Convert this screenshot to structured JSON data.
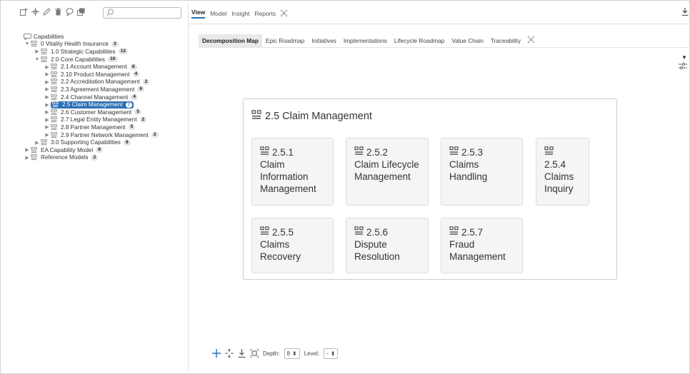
{
  "toolbar": {
    "icons": [
      "add-icon",
      "move-icon",
      "edit-icon",
      "delete-icon",
      "comment-icon",
      "copy-icon"
    ],
    "search_placeholder": ""
  },
  "tree": {
    "root_label": "Capabilities",
    "items": [
      {
        "label": "0 Vitality Health Insurance",
        "badge": "3",
        "level": 0,
        "expanded": true
      },
      {
        "label": "1.0 Strategic Capabilities",
        "badge": "12",
        "level": 1,
        "expanded": false
      },
      {
        "label": "2.0 Core Capabilities",
        "badge": "10",
        "level": 1,
        "expanded": true
      },
      {
        "label": "2.1 Account Management",
        "badge": "8",
        "level": 2,
        "expanded": false
      },
      {
        "label": "2.10 Product Management",
        "badge": "4",
        "level": 2,
        "expanded": false
      },
      {
        "label": "2.2 Accreditation Management",
        "badge": "2",
        "level": 2,
        "expanded": false
      },
      {
        "label": "2.3 Agreement Management",
        "badge": "6",
        "level": 2,
        "expanded": false
      },
      {
        "label": "2.4 Channel Management",
        "badge": "4",
        "level": 2,
        "expanded": false
      },
      {
        "label": "2.5 Claim Management",
        "badge": "7",
        "level": 2,
        "expanded": false,
        "selected": true
      },
      {
        "label": "2.6 Customer Management",
        "badge": "5",
        "level": 2,
        "expanded": false
      },
      {
        "label": "2.7 Legal Entity Management",
        "badge": "2",
        "level": 2,
        "expanded": false
      },
      {
        "label": "2.8 Partner Management",
        "badge": "5",
        "level": 2,
        "expanded": false
      },
      {
        "label": "2.9 Partner Network Management",
        "badge": "2",
        "level": 2,
        "expanded": false
      },
      {
        "label": "3.0 Supporting Capabilities",
        "badge": "9",
        "level": 1,
        "expanded": false
      },
      {
        "label": "EA Capability Model",
        "badge": "8",
        "level": 0,
        "expanded": false
      },
      {
        "label": "Reference Models",
        "badge": "2",
        "level": 0,
        "expanded": false
      }
    ]
  },
  "top_tabs": [
    "View",
    "Model",
    "Insight",
    "Reports"
  ],
  "top_tab_active": "View",
  "sub_tabs": [
    "Decomposition Map",
    "Epic Roadmap",
    "Initiatives",
    "Implementations",
    "Lifecycle Roadmap",
    "Value Chain",
    "Traceability"
  ],
  "sub_tab_active": "Decomposition Map",
  "map": {
    "title": "2.5 Claim Management",
    "cards": [
      {
        "num": "2.5.1",
        "name": "Claim Information Management"
      },
      {
        "num": "2.5.2",
        "name": "Claim Lifecycle Management"
      },
      {
        "num": "2.5.3",
        "name": "Claims Handling"
      },
      {
        "num": "2.5.4",
        "name": "Claims Inquiry"
      },
      {
        "num": "2.5.5",
        "name": "Claims Recovery"
      },
      {
        "num": "2.5.6",
        "name": "Dispute Resolution"
      },
      {
        "num": "2.5.7",
        "name": "Fraud Management"
      }
    ]
  },
  "bottom": {
    "depth_label": "Depth:",
    "depth_value": "8",
    "level_label": "Level:",
    "level_value": "-"
  },
  "colors": {
    "accent": "#2b6fb5",
    "card_bg": "#f5f5f5"
  }
}
